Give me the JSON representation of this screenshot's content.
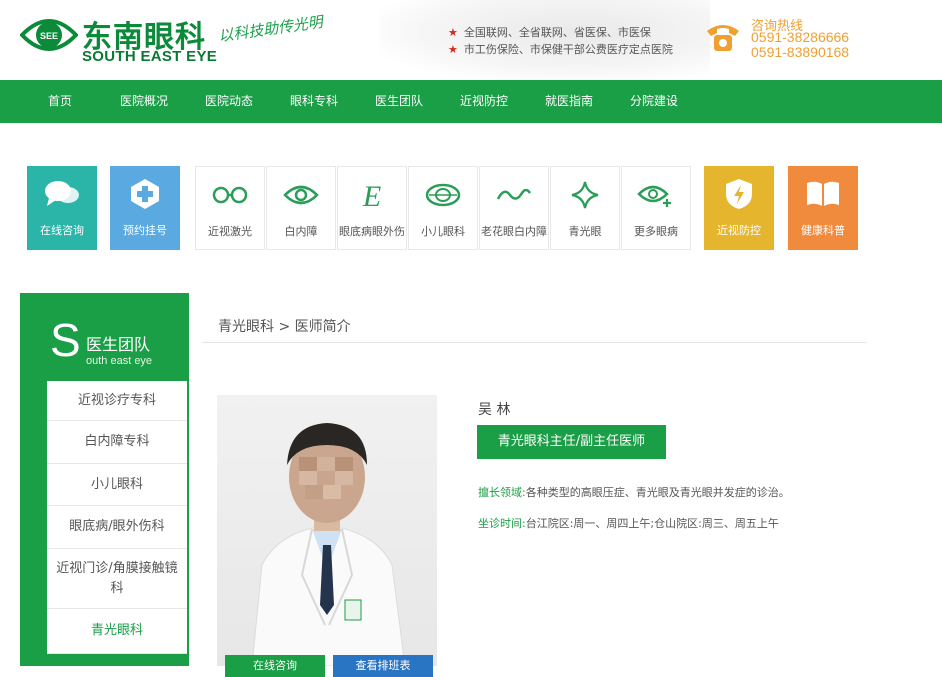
{
  "brand": {
    "name_cn": "东南眼科",
    "name_en": "SOUTH EAST EYE",
    "emblem": "SEE",
    "slogan": "以科技助传光明",
    "primary_color": "#1a9e46",
    "accent_color": "#f0a030"
  },
  "header": {
    "notices": [
      "全国联网、全省联网、省医保、市医保",
      "市工伤保险、市保健干部公费医疗定点医院"
    ],
    "hotline_label": "咨询热线",
    "hotline_numbers": [
      "0591-38286666",
      "0591-83890168"
    ],
    "phone_icon": "phone-icon"
  },
  "nav": [
    "首页",
    "医院概况",
    "医院动态",
    "眼科专科",
    "医生团队",
    "近视防控",
    "就医指南",
    "分院建设"
  ],
  "tiles": [
    {
      "label": "在线咨询",
      "icon": "chat-bubbles-icon",
      "color": "#2bb5a8"
    },
    {
      "label": "预约挂号",
      "icon": "medical-cross-icon",
      "color": "#5aa9e0"
    },
    {
      "label": "近视激光",
      "icon": "glasses-icon"
    },
    {
      "label": "白内障",
      "icon": "eye-icon"
    },
    {
      "label": "眼底病眼外伤",
      "icon": "letter-e-icon"
    },
    {
      "label": "小儿眼科",
      "icon": "eye-oval-icon"
    },
    {
      "label": "老花眼白内障",
      "icon": "wave-icon"
    },
    {
      "label": "青光眼",
      "icon": "sparkle-icon"
    },
    {
      "label": "更多眼病",
      "icon": "eye-plus-icon"
    },
    {
      "label": "近视防控",
      "icon": "shield-bolt-icon",
      "color": "#e6b52e"
    },
    {
      "label": "健康科普",
      "icon": "open-book-icon",
      "color": "#f08a3c"
    }
  ],
  "sidebar": {
    "letter": "S",
    "title": "医生团队",
    "subtitle": "outh east eye",
    "items": [
      "近视诊疗专科",
      "白内障专科",
      "小儿眼科",
      "眼底病/眼外伤科",
      "近视门诊/角膜接触镜科",
      "青光眼科"
    ],
    "active_item": "青光眼科"
  },
  "main": {
    "breadcrumb": "青光眼科 > 医师简介",
    "doctor_name": "吴  林",
    "doctor_title": "青光眼科主任/副主任医师",
    "specialty_label": "擅长领域:",
    "specialty_text": "各种类型的高眼压症、青光眼及青光眼并发症的诊治。",
    "schedule_label": "坐诊时间:",
    "schedule_text": "台江院区:周一、周四上午;仓山院区:周三、周五上午",
    "photo_buttons": [
      "在线咨询",
      "查看排班表"
    ]
  }
}
